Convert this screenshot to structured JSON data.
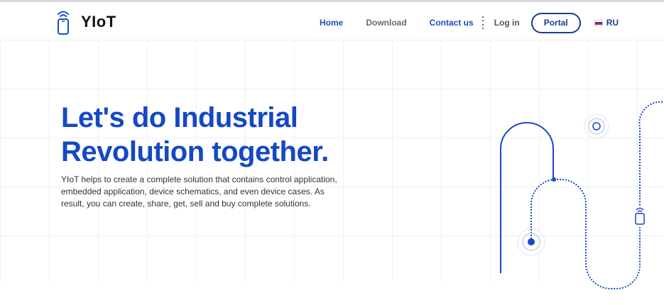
{
  "brand": {
    "name": "YIoT",
    "logo_icon": "phone-wifi-icon"
  },
  "nav": {
    "home": "Home",
    "download": "Download",
    "contact": "Contact us",
    "login": "Log in",
    "portal": "Portal",
    "language": "RU"
  },
  "hero": {
    "title_line1": "Let's do Industrial",
    "title_line2": "Revolution together.",
    "description": "YIoT helps to create a complete solution that contains control application, embedded application, device schematics, and even device cases. As result, you can create, share, get, sell and buy complete solutions."
  },
  "colors": {
    "brand_blue": "#1448c5",
    "portal_outline": "#1a3f8f",
    "muted_link": "#6b6b6b"
  }
}
